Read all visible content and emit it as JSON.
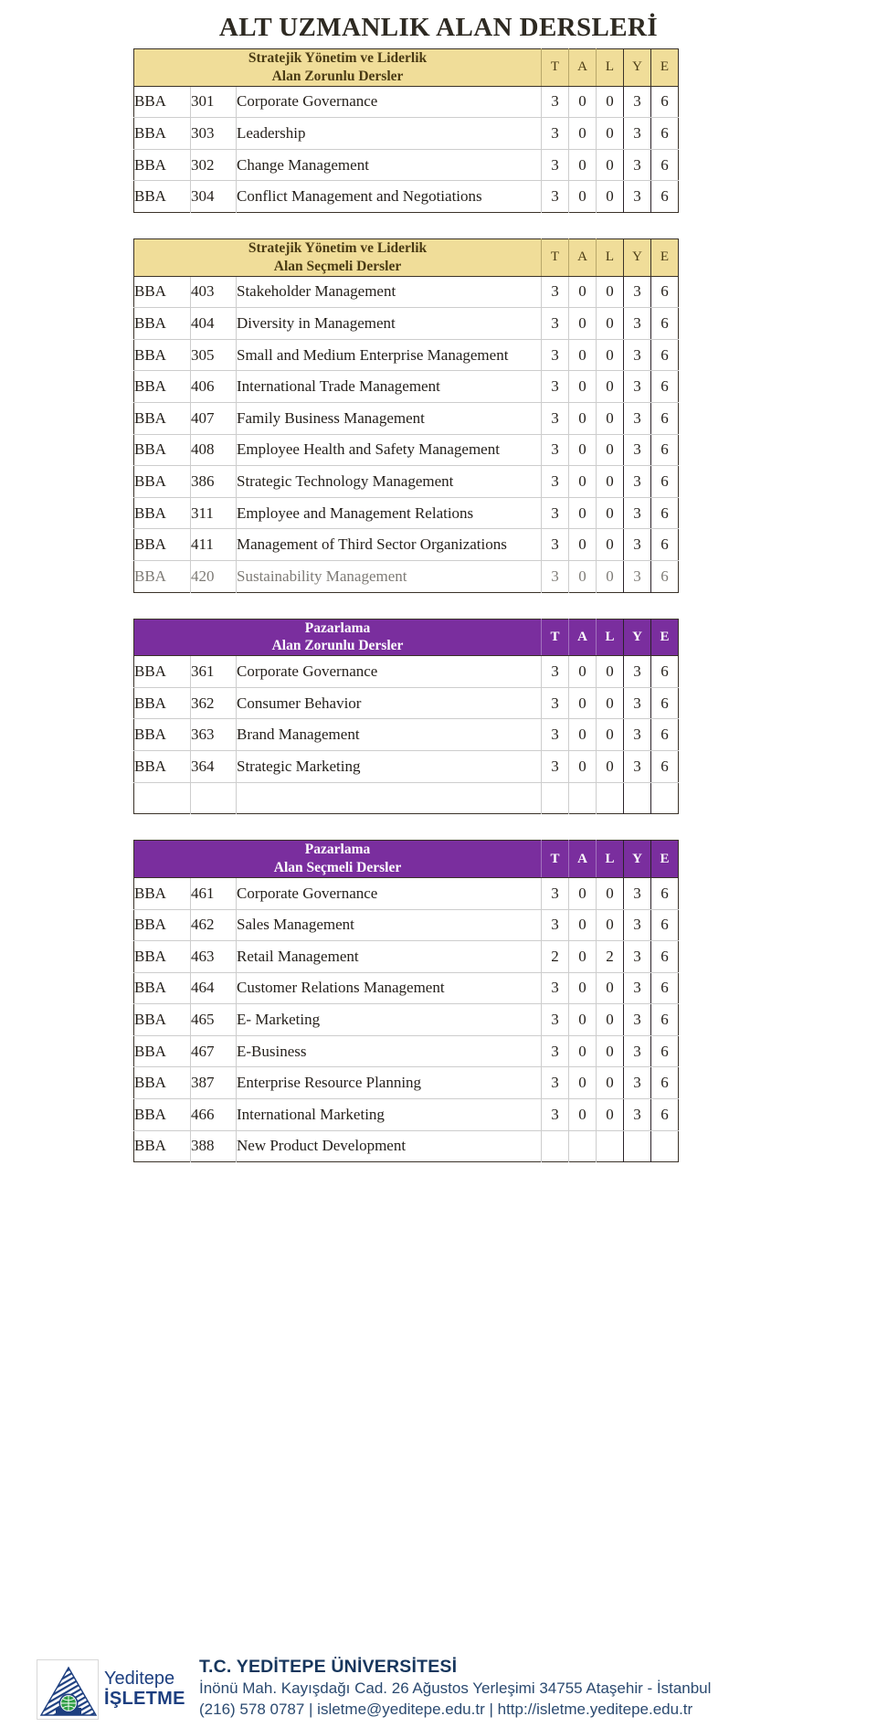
{
  "page": {
    "title": "ALT UZMANLIK ALAN DERSLERİ"
  },
  "colors": {
    "header_yellow": "#f0dd99",
    "header_yellow_text": "#4a3b14",
    "header_purple": "#7a2e9e",
    "header_purple_text": "#ffffff",
    "e_column_fill": "#e3e3e3",
    "footer_blue": "#17365d",
    "logo_blue": "#1d3f80",
    "logo_green": "#2f9e44"
  },
  "column_headers": {
    "t": "T",
    "a": "A",
    "l": "L",
    "y": "Y",
    "e": "E"
  },
  "tables": [
    {
      "theme": "yellow",
      "title_line1": "Stratejik Yönetim ve Liderlik",
      "title_line2": "Alan Zorunlu Dersler",
      "rows": [
        {
          "prefix": "BBA",
          "code": "301",
          "name": "Corporate Governance",
          "t": "3",
          "a": "0",
          "l": "0",
          "y": "3",
          "e": "6",
          "muted": false
        },
        {
          "prefix": "BBA",
          "code": "303",
          "name": "Leadership",
          "t": "3",
          "a": "0",
          "l": "0",
          "y": "3",
          "e": "6",
          "muted": false
        },
        {
          "prefix": "BBA",
          "code": "302",
          "name": "Change Management",
          "t": "3",
          "a": "0",
          "l": "0",
          "y": "3",
          "e": "6",
          "muted": false
        },
        {
          "prefix": "BBA",
          "code": "304",
          "name": "Conflict Management and Negotiations",
          "t": "3",
          "a": "0",
          "l": "0",
          "y": "3",
          "e": "6",
          "muted": false
        }
      ]
    },
    {
      "theme": "yellow",
      "title_line1": "Stratejik Yönetim ve Liderlik",
      "title_line2": "Alan Seçmeli Dersler",
      "rows": [
        {
          "prefix": "BBA",
          "code": "403",
          "name": "Stakeholder Management",
          "t": "3",
          "a": "0",
          "l": "0",
          "y": "3",
          "e": "6",
          "muted": false
        },
        {
          "prefix": "BBA",
          "code": "404",
          "name": "Diversity in Management",
          "t": "3",
          "a": "0",
          "l": "0",
          "y": "3",
          "e": "6",
          "muted": false
        },
        {
          "prefix": "BBA",
          "code": "305",
          "name": "Small and Medium Enterprise Management",
          "t": "3",
          "a": "0",
          "l": "0",
          "y": "3",
          "e": "6",
          "muted": false
        },
        {
          "prefix": "BBA",
          "code": "406",
          "name": "International Trade Management",
          "t": "3",
          "a": "0",
          "l": "0",
          "y": "3",
          "e": "6",
          "muted": false
        },
        {
          "prefix": "BBA",
          "code": "407",
          "name": "Family Business Management",
          "t": "3",
          "a": "0",
          "l": "0",
          "y": "3",
          "e": "6",
          "muted": false
        },
        {
          "prefix": "BBA",
          "code": "408",
          "name": "Employee Health and Safety Management",
          "t": "3",
          "a": "0",
          "l": "0",
          "y": "3",
          "e": "6",
          "muted": false
        },
        {
          "prefix": "BBA",
          "code": "386",
          "name": "Strategic Technology Management",
          "t": "3",
          "a": "0",
          "l": "0",
          "y": "3",
          "e": "6",
          "muted": false
        },
        {
          "prefix": "BBA",
          "code": "311",
          "name": "Employee and Management Relations",
          "t": "3",
          "a": "0",
          "l": "0",
          "y": "3",
          "e": "6",
          "muted": false
        },
        {
          "prefix": "BBA",
          "code": "411",
          "name": "Management of Third Sector Organizations",
          "t": "3",
          "a": "0",
          "l": "0",
          "y": "3",
          "e": "6",
          "muted": false
        },
        {
          "prefix": "BBA",
          "code": "420",
          "name": "Sustainability Management",
          "t": "3",
          "a": "0",
          "l": "0",
          "y": "3",
          "e": "6",
          "muted": true
        }
      ]
    },
    {
      "theme": "purple",
      "title_line1": "Pazarlama",
      "title_line2": "Alan Zorunlu Dersler",
      "rows": [
        {
          "prefix": "BBA",
          "code": "361",
          "name": "Corporate Governance",
          "t": "3",
          "a": "0",
          "l": "0",
          "y": "3",
          "e": "6",
          "muted": false
        },
        {
          "prefix": "BBA",
          "code": "362",
          "name": "Consumer Behavior",
          "t": "3",
          "a": "0",
          "l": "0",
          "y": "3",
          "e": "6",
          "muted": false
        },
        {
          "prefix": "BBA",
          "code": "363",
          "name": "Brand Management",
          "t": "3",
          "a": "0",
          "l": "0",
          "y": "3",
          "e": "6",
          "muted": false
        },
        {
          "prefix": "BBA",
          "code": "364",
          "name": "Strategic Marketing",
          "t": "3",
          "a": "0",
          "l": "0",
          "y": "3",
          "e": "6",
          "muted": false
        },
        {
          "prefix": "",
          "code": "",
          "name": "",
          "t": "",
          "a": "",
          "l": "",
          "y": "",
          "e": "",
          "muted": false,
          "empty": true
        }
      ]
    },
    {
      "theme": "purple",
      "title_line1": "Pazarlama",
      "title_line2": "Alan Seçmeli Dersler",
      "rows": [
        {
          "prefix": "BBA",
          "code": "461",
          "name": "Corporate Governance",
          "t": "3",
          "a": "0",
          "l": "0",
          "y": "3",
          "e": "6",
          "muted": false
        },
        {
          "prefix": "BBA",
          "code": "462",
          "name": "Sales Management",
          "t": "3",
          "a": "0",
          "l": "0",
          "y": "3",
          "e": "6",
          "muted": false
        },
        {
          "prefix": "BBA",
          "code": "463",
          "name": "Retail Management",
          "t": "2",
          "a": "0",
          "l": "2",
          "y": "3",
          "e": "6",
          "muted": false
        },
        {
          "prefix": "BBA",
          "code": "464",
          "name": "Customer Relations Management",
          "t": "3",
          "a": "0",
          "l": "0",
          "y": "3",
          "e": "6",
          "muted": false
        },
        {
          "prefix": "BBA",
          "code": "465",
          "name": "E- Marketing",
          "t": "3",
          "a": "0",
          "l": "0",
          "y": "3",
          "e": "6",
          "muted": false
        },
        {
          "prefix": "BBA",
          "code": "467",
          "name": "E-Business",
          "t": "3",
          "a": "0",
          "l": "0",
          "y": "3",
          "e": "6",
          "muted": false
        },
        {
          "prefix": "BBA",
          "code": "387",
          "name": "Enterprise Resource Planning",
          "t": "3",
          "a": "0",
          "l": "0",
          "y": "3",
          "e": "6",
          "muted": false
        },
        {
          "prefix": "BBA",
          "code": "466",
          "name": "International Marketing",
          "t": "3",
          "a": "0",
          "l": "0",
          "y": "3",
          "e": "6",
          "muted": false
        },
        {
          "prefix": "BBA",
          "code": "388",
          "name": "New Product Development",
          "t": "",
          "a": "",
          "l": "",
          "y": "",
          "e": "",
          "muted": false
        }
      ]
    }
  ],
  "footer": {
    "logo_word_top": "Yeditepe",
    "logo_word_bottom": "İŞLETME",
    "university": "T.C. YEDİTEPE ÜNİVERSİTESİ",
    "address": "İnönü Mah. Kayışdağı Cad. 26 Ağustos Yerleşimi 34755 Ataşehir - İstanbul",
    "contact": "(216) 578 0787 | isletme@yeditepe.edu.tr | http://isletme.yeditepe.edu.tr"
  }
}
